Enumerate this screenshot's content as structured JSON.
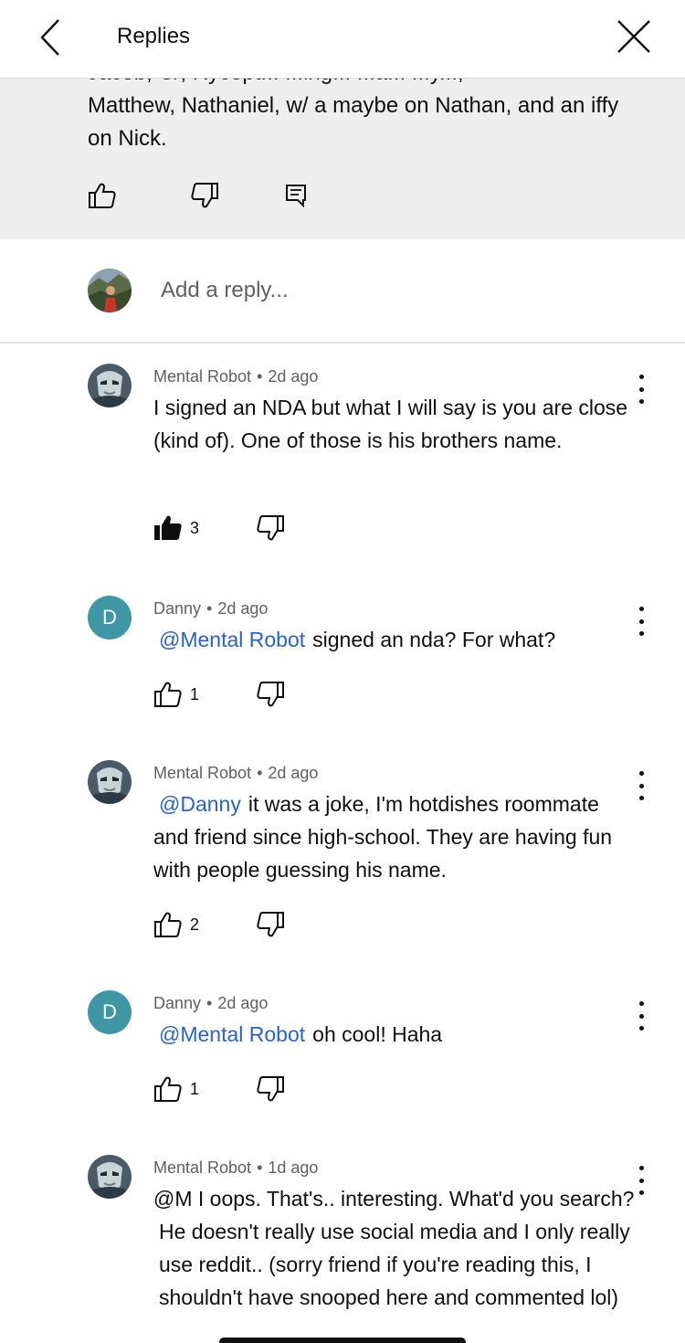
{
  "header": {
    "title": "Replies"
  },
  "parent": {
    "cut_line": "Jacob, C/, Rycept... ...ing... ...a... ...y...,",
    "text": "Matthew, Nathaniel, w/ a maybe on Nathan, and an iffy on Nick."
  },
  "reply_box": {
    "placeholder": "Add a reply..."
  },
  "comments": [
    {
      "author": "Mental Robot",
      "sep": "•",
      "time": "2d ago",
      "mention": "",
      "text": "I signed an NDA but what I will say is you are close (kind of). One of those is his brothers name.",
      "likes": "3",
      "liked": true,
      "avatar": "robot"
    },
    {
      "author": "Danny",
      "sep": "•",
      "time": "2d ago",
      "mention": "@Mental Robot",
      "text": "signed an nda? For what?",
      "likes": "1",
      "liked": false,
      "avatar": "D"
    },
    {
      "author": "Mental Robot",
      "sep": "•",
      "time": "2d ago",
      "mention": "@Danny",
      "text": "it was a joke, I'm hotdishes roommate and friend since high-school. They are having fun with people guessing his name.",
      "likes": "2",
      "liked": false,
      "avatar": "robot"
    },
    {
      "author": "Danny",
      "sep": "•",
      "time": "2d ago",
      "mention": "@Mental Robot",
      "text": "oh cool! Haha",
      "likes": "1",
      "liked": false,
      "avatar": "D"
    },
    {
      "author": "Mental Robot",
      "sep": "•",
      "time": "1d ago",
      "mention": "",
      "text": "@M I  oops. That's.. interesting. What'd you search? He doesn't really use social media and I only really use reddit.. (sorry friend if you're reading this, I shouldn't have snooped here and commented lol)",
      "likes": "",
      "liked": false,
      "avatar": "robot"
    }
  ],
  "colors": {
    "mention": "#2a63c6",
    "avatar_d": "#3f97a5",
    "parent_bg": "#eeeeee"
  }
}
